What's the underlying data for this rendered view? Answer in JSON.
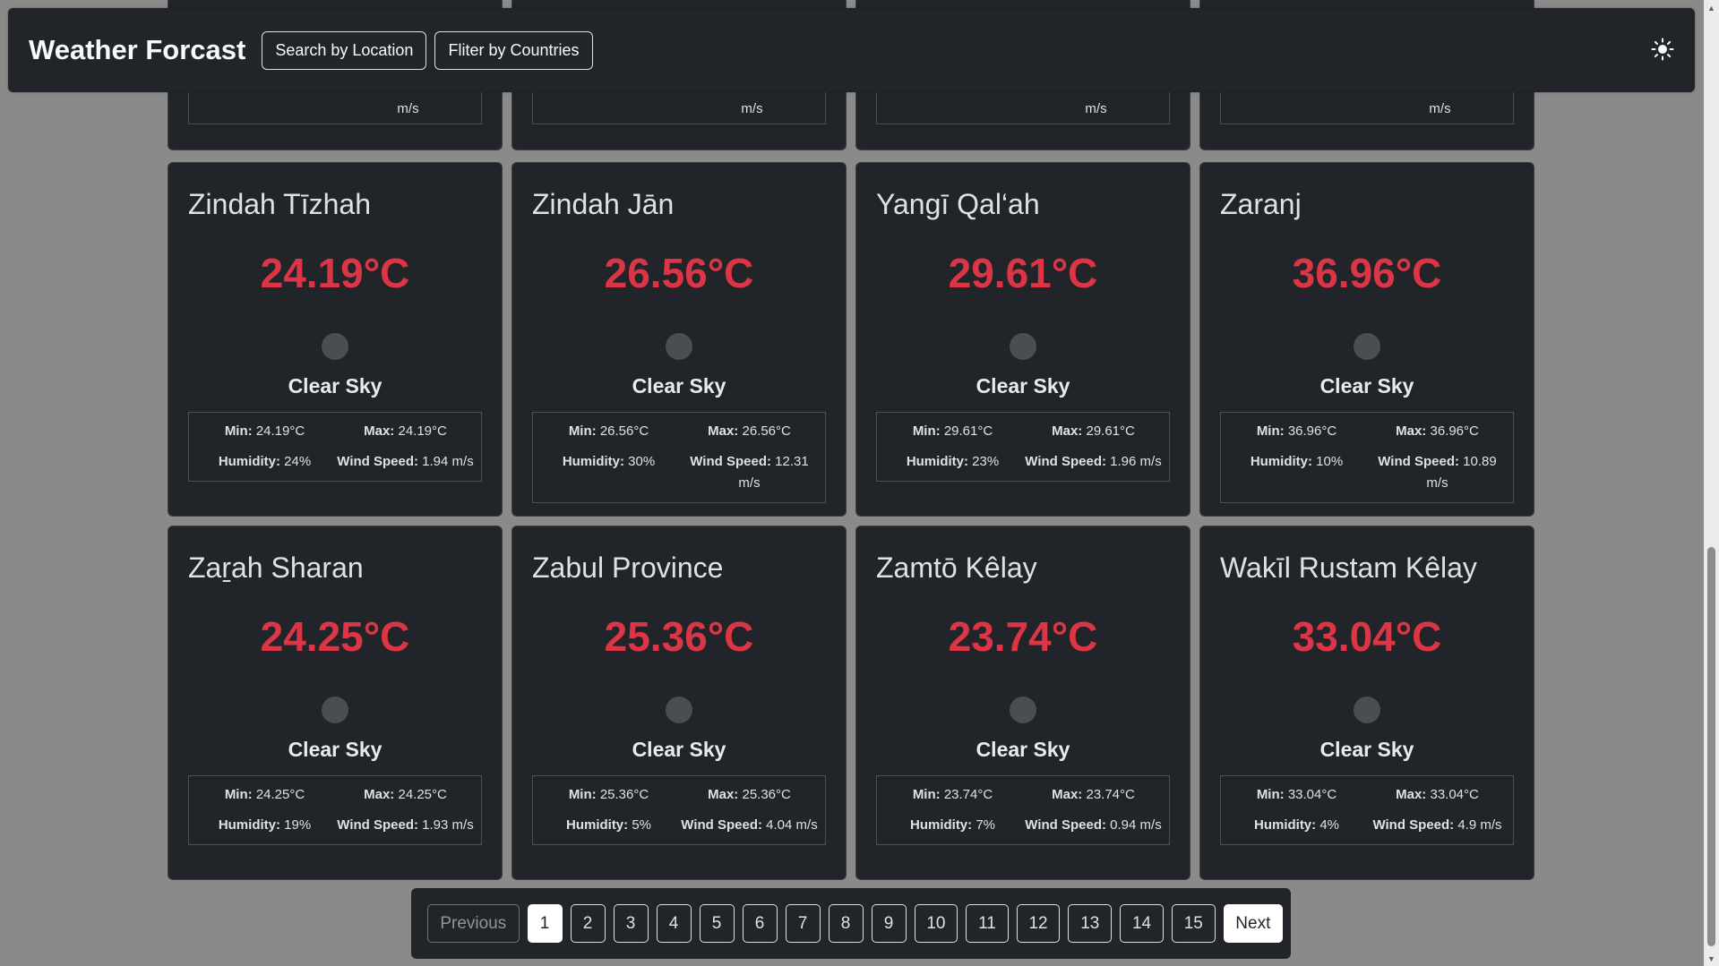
{
  "header": {
    "title": "Weather Forcast",
    "search_label": "Search by Location",
    "filter_label": "Fliter by Countries"
  },
  "top_partial": {
    "wind_unit": "m/s"
  },
  "cards": [
    {
      "city": "Zindah Tīzhah",
      "temp": "24.19°C",
      "desc": "Clear Sky",
      "min": "24.19°C",
      "max": "24.19°C",
      "humidity": "24%",
      "wind": "1.94 m/s"
    },
    {
      "city": "Zindah Jān",
      "temp": "26.56°C",
      "desc": "Clear Sky",
      "min": "26.56°C",
      "max": "26.56°C",
      "humidity": "30%",
      "wind": "12.31 m/s"
    },
    {
      "city": "Yangī Qal‘ah",
      "temp": "29.61°C",
      "desc": "Clear Sky",
      "min": "29.61°C",
      "max": "29.61°C",
      "humidity": "23%",
      "wind": "1.96 m/s"
    },
    {
      "city": "Zaranj",
      "temp": "36.96°C",
      "desc": "Clear Sky",
      "min": "36.96°C",
      "max": "36.96°C",
      "humidity": "10%",
      "wind": "10.89 m/s"
    },
    {
      "city": "Zaṟah Sharan",
      "temp": "24.25°C",
      "desc": "Clear Sky",
      "min": "24.25°C",
      "max": "24.25°C",
      "humidity": "19%",
      "wind": "1.93 m/s"
    },
    {
      "city": "Zabul Province",
      "temp": "25.36°C",
      "desc": "Clear Sky",
      "min": "25.36°C",
      "max": "25.36°C",
      "humidity": "5%",
      "wind": "4.04 m/s"
    },
    {
      "city": "Zamtō Kêlay",
      "temp": "23.74°C",
      "desc": "Clear Sky",
      "min": "23.74°C",
      "max": "23.74°C",
      "humidity": "7%",
      "wind": "0.94 m/s"
    },
    {
      "city": "Wakīl Rustam Kêlay",
      "temp": "33.04°C",
      "desc": "Clear Sky",
      "min": "33.04°C",
      "max": "33.04°C",
      "humidity": "4%",
      "wind": "4.9 m/s"
    }
  ],
  "labels": {
    "min": "Min:",
    "max": "Max:",
    "humidity": "Humidity:",
    "wind": "Wind Speed:"
  },
  "pagination": {
    "previous": "Previous",
    "pages": [
      "1",
      "2",
      "3",
      "4",
      "5",
      "6",
      "7",
      "8",
      "9",
      "10",
      "11",
      "12",
      "13",
      "14",
      "15"
    ],
    "active": "1",
    "next": "Next"
  },
  "colors": {
    "temp": "#dc3545",
    "card": "#212529",
    "background": "#8a8a8a"
  }
}
